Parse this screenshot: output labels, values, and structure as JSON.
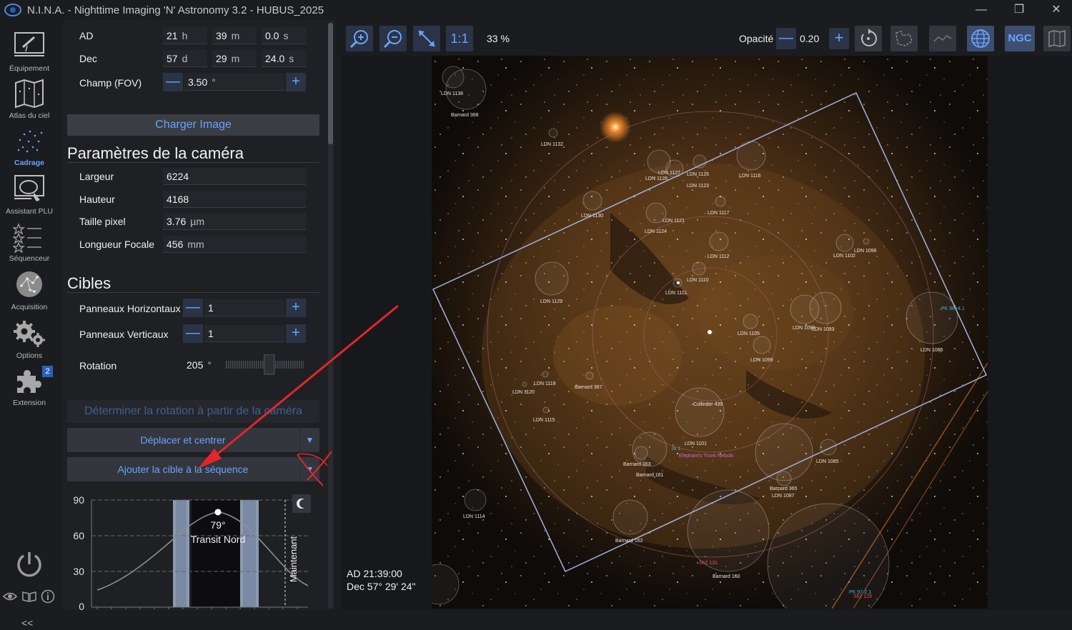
{
  "window": {
    "title": "N.I.N.A. - Nighttime Imaging 'N' Astronomy 3.2   -  HUBUS_2025",
    "minimize": "—",
    "maximize": "❐",
    "close": "✕"
  },
  "nav": {
    "items": [
      {
        "label": "Équipement",
        "icon": "telescope-icon"
      },
      {
        "label": "Atlas du ciel",
        "icon": "sky-atlas-icon"
      },
      {
        "label": "Cadrage",
        "icon": "framing-icon",
        "active": true
      },
      {
        "label": "Assistant PLU",
        "icon": "flat-wizard-icon"
      },
      {
        "label": "Séquenceur",
        "icon": "sequencer-icon"
      },
      {
        "label": "Acquisition",
        "icon": "imaging-icon"
      },
      {
        "label": "Options",
        "icon": "gear-icon"
      },
      {
        "label": "Extension",
        "icon": "puzzle-icon",
        "badge": "2"
      }
    ],
    "collapse": "<<",
    "active_color": "#6aa3ff"
  },
  "coordinates": {
    "ra_label": "AD",
    "ra": {
      "h": "21",
      "h_unit": "h",
      "m": "39",
      "m_unit": "m",
      "s": "0.0",
      "s_unit": "s"
    },
    "dec_label": "Dec",
    "dec": {
      "d": "57",
      "d_unit": "d",
      "m": "29",
      "m_unit": "m",
      "s": "24.0",
      "s_unit": "s"
    },
    "fov_label": "Champ (FOV)",
    "fov_value": "3.50",
    "fov_unit": "°"
  },
  "load_image_button": "Charger Image",
  "camera": {
    "title": "Paramètres de la caméra",
    "width_label": "Largeur",
    "width": "6224",
    "height_label": "Hauteur",
    "height": "4168",
    "pixel_label": "Taille pixel",
    "pixel": "3.76",
    "pixel_unit": "µm",
    "focal_label": "Longueur Focale",
    "focal": "456",
    "focal_unit": "mm"
  },
  "targets": {
    "title": "Cibles",
    "hpanels_label": "Panneaux Horizontaux",
    "hpanels": "1",
    "vpanels_label": "Panneaux Verticaux",
    "vpanels": "1",
    "rotation_label": "Rotation",
    "rotation": "205",
    "rotation_unit": "°",
    "rotation_fraction": 0.57
  },
  "buttons": {
    "camera_rotation": "Déterminer la rotation à partir de la caméra",
    "slew_center": "Déplacer et centrer",
    "add_target": "Ajouter la cible à la séquence",
    "dropdown": "▼"
  },
  "altitude_chart": {
    "y_ticks": [
      "90",
      "60",
      "30",
      "0"
    ],
    "peak_label": "79°",
    "transit_label": "Transit Nord",
    "now_label": "Maintenant"
  },
  "toolbar": {
    "one_to_one": "1:1",
    "zoom": "33 %",
    "opacity_label": "Opacité",
    "opacity": "0.20",
    "ngc": "NGC"
  },
  "cursor_coords": {
    "ra": "AD  21:39:00",
    "dec": "Dec  57° 29' 24\""
  },
  "sky_labels": {
    "ldn1138": "LDN 1138",
    "b368": "Barnard 368",
    "ldn1132": "LDN 1132",
    "ldn1127": "LDN 1127",
    "ldn1128": "LDN 1128",
    "ldn1126": "LDN 1126",
    "ldn1123": "LDN 1123",
    "ldn1116": "LDN 1116",
    "ldn1130": "LDN 1130",
    "ldn1121": "LDN 1121",
    "ldn1117": "LDN 1117",
    "ldn1124": "LDN 1124",
    "ldn1112": "LDN 1112",
    "ldn1102": "LDN 1102",
    "ldn1096": "LDN 1096",
    "ldn1110": "LDN 1110",
    "ldn1111": "LDN 1111",
    "ldn1129": "LDN 1129",
    "ldn1105": "LDN 1105",
    "ldn1098": "LDN 1098",
    "ldn1093": "LDN 1093",
    "ldn1099": "LDN 1099",
    "pk": "PK 98+4.1",
    "ldn1086": "LDN 1086",
    "ldn1118": "LDN 1118",
    "ldn1120": "LDN 1120",
    "b367": "Barnard 367",
    "cr439": "Collinder 439",
    "ldn1115": "LDN 1115",
    "ldn1101": "LDN 1101",
    "jo1": "Jo 1",
    "elephant": "Elephant's Trunk Nebula",
    "b163": "Barnard 163",
    "b161": "Barnard 161",
    "ldn1085": "LDN 1085",
    "b365": "Barnard 365",
    "ldn1087": "LDN 1087",
    "ldn1114": "LDN 1114",
    "b162": "Barnard 162",
    "sh2131": "Sh2 131",
    "b160": "Barnard 160",
    "pk2": "PK 97-2.1",
    "sh2129": "Sh2 129"
  },
  "colors": {
    "accent": "#6aa3ff",
    "annotation_red": "#e3262b",
    "frame_blue": "#9fb4e0",
    "nebula_orange": "#b3742d"
  }
}
